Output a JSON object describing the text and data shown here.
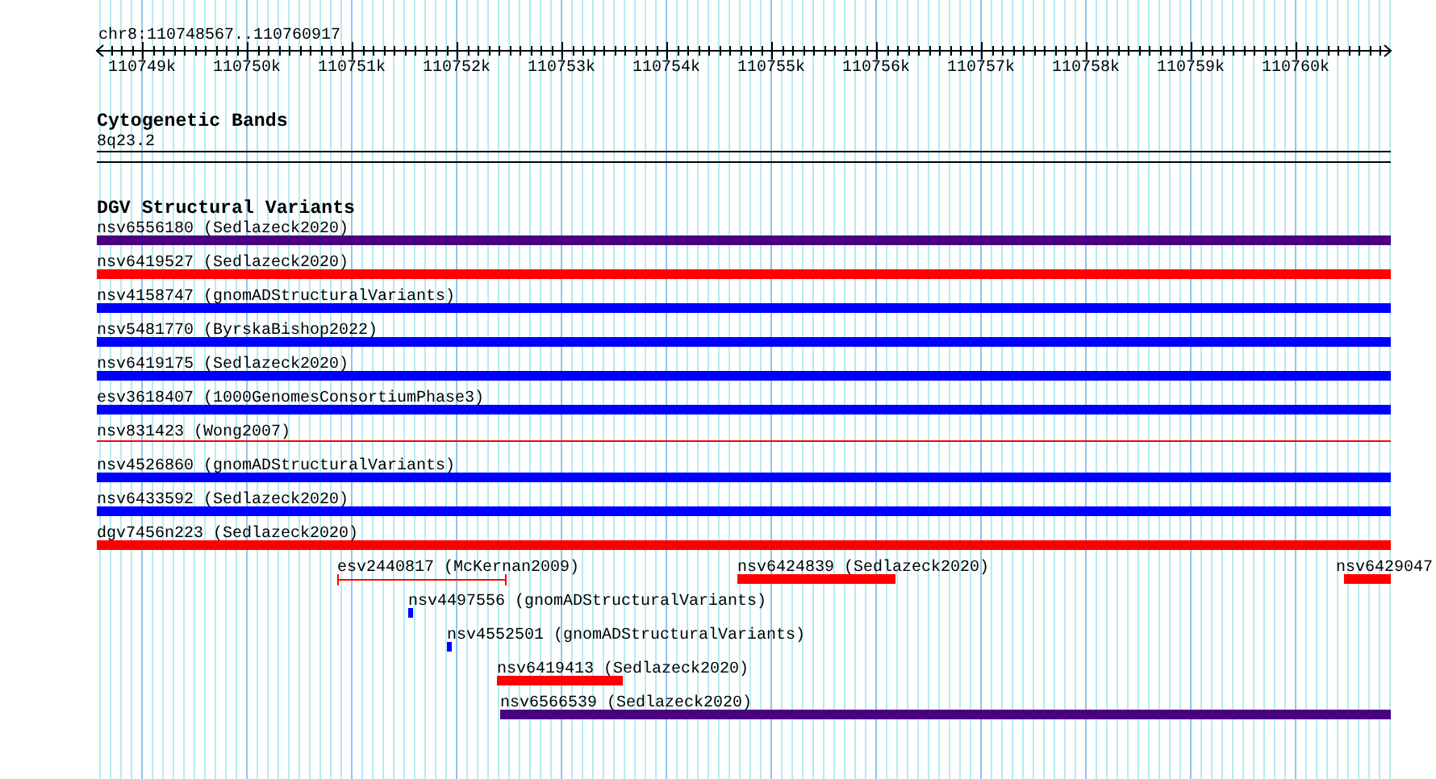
{
  "location": "chr8:110748567..110760917",
  "ruler": {
    "labels": [
      "110749k",
      "110750k",
      "110751k",
      "110752k",
      "110753k",
      "110754k",
      "110755k",
      "110756k",
      "110757k",
      "110758k",
      "110759k",
      "110760k"
    ]
  },
  "cytogenetic_bands": {
    "title": "Cytogenetic Bands",
    "band": "8q23.2"
  },
  "dgv": {
    "title": "DGV Structural Variants",
    "lanes": [
      [
        {
          "label": "nsv6556180 (Sedlazeck2020)",
          "kind": "bar",
          "color": "#4b0082"
        }
      ],
      [
        {
          "label": "nsv6419527 (Sedlazeck2020)",
          "kind": "bar",
          "color": "#ff0000"
        }
      ],
      [
        {
          "label": "nsv4158747 (gnomADStructuralVariants)",
          "kind": "bar",
          "color": "#0000ff"
        }
      ],
      [
        {
          "label": "nsv5481770 (ByrskaBishop2022)",
          "kind": "bar",
          "color": "#0000ff"
        }
      ],
      [
        {
          "label": "nsv6419175 (Sedlazeck2020)",
          "kind": "bar",
          "color": "#0000ff"
        }
      ],
      [
        {
          "label": "esv3618407 (1000GenomesConsortiumPhase3)",
          "kind": "bar",
          "color": "#0000ff"
        }
      ],
      [
        {
          "label": "nsv831423 (Wong2007)",
          "kind": "line",
          "color": "#ff0000"
        }
      ],
      [
        {
          "label": "nsv4526860 (gnomADStructuralVariants)",
          "kind": "bar",
          "color": "#0000ff"
        }
      ],
      [
        {
          "label": "nsv6433592 (Sedlazeck2020)",
          "kind": "bar",
          "color": "#0000ff"
        }
      ],
      [
        {
          "label": "dgv7456n223 (Sedlazeck2020)",
          "kind": "bar",
          "color": "#ff0000"
        }
      ],
      [
        {
          "label": "esv2440817 (McKernan2009)",
          "kind": "interval",
          "color": "#ff0000"
        },
        {
          "label": "nsv6424839 (Sedlazeck2020)",
          "kind": "bar",
          "color": "#ff0000"
        },
        {
          "label": "nsv6429047",
          "kind": "bar",
          "color": "#ff0000"
        }
      ],
      [
        {
          "label": "nsv4497556 (gnomADStructuralVariants)",
          "kind": "bar",
          "color": "#0000ff"
        }
      ],
      [
        {
          "label": "nsv4552501 (gnomADStructuralVariants)",
          "kind": "bar",
          "color": "#0000ff"
        }
      ],
      [
        {
          "label": "nsv6419413 (Sedlazeck2020)",
          "kind": "bar",
          "color": "#ff0000"
        }
      ],
      [
        {
          "label": "nsv6566539 (Sedlazeck2020)",
          "kind": "bar",
          "color": "#4b0082"
        }
      ]
    ]
  }
}
